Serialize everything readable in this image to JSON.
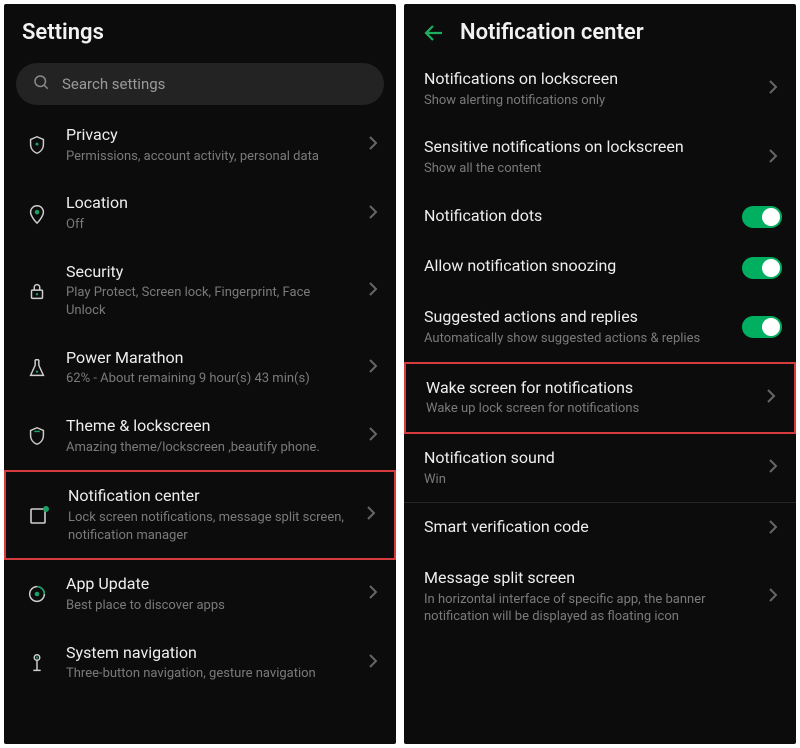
{
  "left": {
    "title": "Settings",
    "search_placeholder": "Search settings",
    "items": [
      {
        "title": "Privacy",
        "sub": "Permissions, account activity, personal data"
      },
      {
        "title": "Location",
        "sub": "Off"
      },
      {
        "title": "Security",
        "sub": "Play Protect, Screen lock, Fingerprint, Face Unlock"
      },
      {
        "title": "Power Marathon",
        "sub": "62% - About remaining 9 hour(s)  43 min(s)"
      },
      {
        "title": "Theme & lockscreen",
        "sub": "Amazing theme/lockscreen ,beautify phone."
      },
      {
        "title": "Notification center",
        "sub": "Lock screen notifications, message split screen, notification manager"
      },
      {
        "title": "App Update",
        "sub": "Best place to discover apps"
      },
      {
        "title": "System navigation",
        "sub": "Three-button navigation, gesture navigation"
      }
    ]
  },
  "right": {
    "title": "Notification center",
    "items": [
      {
        "title": "Notifications on lockscreen",
        "sub": "Show alerting notifications only",
        "kind": "nav"
      },
      {
        "title": "Sensitive notifications on lockscreen",
        "sub": "Show all the content",
        "kind": "nav"
      },
      {
        "title": "Notification dots",
        "sub": "",
        "kind": "toggle"
      },
      {
        "title": "Allow notification snoozing",
        "sub": "",
        "kind": "toggle"
      },
      {
        "title": "Suggested actions and replies",
        "sub": "Automatically show suggested actions & replies",
        "kind": "toggle"
      },
      {
        "title": "Wake screen for notifications",
        "sub": "Wake up lock screen for notifications",
        "kind": "nav"
      },
      {
        "title": "Notification sound",
        "sub": "Win",
        "kind": "nav"
      },
      {
        "title": "Smart verification code",
        "sub": "",
        "kind": "nav"
      },
      {
        "title": "Message split screen",
        "sub": "In horizontal interface of specific app, the banner notification will be displayed as floating icon",
        "kind": "nav"
      }
    ]
  }
}
